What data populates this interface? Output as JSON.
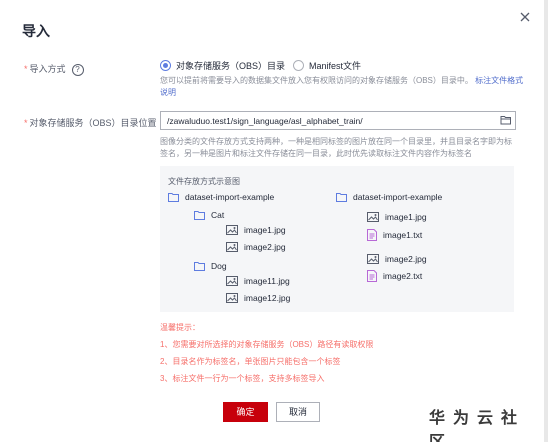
{
  "dialog": {
    "title": "导入",
    "close_label": "×"
  },
  "import_method": {
    "label": "导入方式",
    "help": "?",
    "options": [
      {
        "label": "对象存储服务（OBS）目录",
        "checked": true
      },
      {
        "label": "Manifest文件",
        "checked": false
      }
    ],
    "hint_text": "您可以提前将需要导入的数据集文件放入您有权限访问的对象存储服务（OBS）目录中。",
    "hint_link": "标注文件格式说明"
  },
  "obs_path": {
    "label": "对象存储服务（OBS）目录位置",
    "value": "/zawaluduo.test1/sign_language/asl_alphabet_train/",
    "hint_line1": "图像分类的文件存放方式支持两种，一种是相同标签的图片放在同一个目录里，并且目录名字即为标",
    "hint_line2": "签名，另一种是图片和标注文件存储在同一目录，此时优先读取标注文件内容作为标签名"
  },
  "example": {
    "title": "文件存放方式示意图",
    "left_tree": {
      "root": "dataset-import-example",
      "folders": [
        {
          "name": "Cat",
          "files": [
            "image1.jpg",
            "image2.jpg"
          ]
        },
        {
          "name": "Dog",
          "files": [
            "image11.jpg",
            "image12.jpg"
          ]
        }
      ]
    },
    "right_tree": {
      "root": "dataset-import-example",
      "files": [
        "image1.jpg",
        "image1.txt",
        "image2.jpg",
        "image2.txt"
      ]
    }
  },
  "tips": {
    "title": "温馨提示：",
    "items": [
      "1、您需要对所选择的对象存储服务（OBS）路径有读取权限",
      "2、目录名作为标签名，单张图片只能包含一个标签",
      "3、标注文件一行为一个标签，支持多标签导入"
    ]
  },
  "buttons": {
    "ok": "确定",
    "cancel": "取消"
  },
  "watermark": "华为云社区",
  "colors": {
    "accent": "#5e7ce0",
    "primary_button": "#c7000b",
    "tip_text": "#f66f6a",
    "folder_icon": "#5e7ce0",
    "text_file_icon": "#b768d6"
  }
}
